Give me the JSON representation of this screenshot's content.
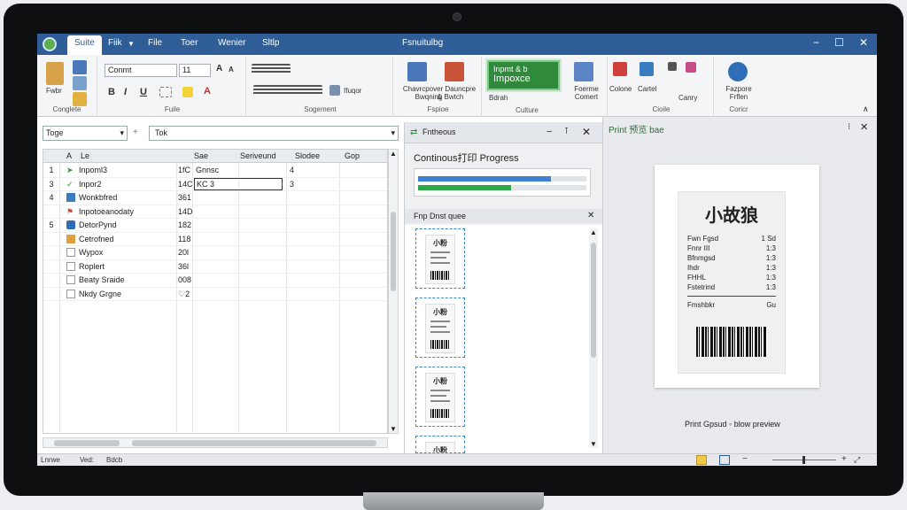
{
  "titlebar": {
    "tabs": [
      "Suite",
      "Fiik",
      "File",
      "Toer",
      "Wenier",
      "Sltlp"
    ],
    "window_title": "Fsnuitulbg",
    "minimize": "−",
    "maximize": "☐",
    "close": "✕"
  },
  "ribbon": {
    "clipboard": {
      "paste": "Fwbr",
      "label": "Conglete"
    },
    "font": {
      "name": "Conmt",
      "size": "11",
      "bold": "B",
      "italic": "I",
      "underline": "U",
      "label": "Fuile"
    },
    "alignment": {
      "label": "Sogement",
      "merge": "Ifuqor"
    },
    "figure": {
      "btn1": "Chavrcpover Dauncpre &",
      "btn2": "Bwqning Bwtch",
      "label": "Fspioe"
    },
    "import": {
      "line1": "Inpmt & b",
      "line2": "Impoxce",
      "line3": "Bdrah",
      "label": "Culture"
    },
    "tools": {
      "btn1": "Foerme",
      "btn2": "Comert",
      "label": ""
    },
    "color": {
      "btn1": "Colone",
      "btn2": "Cartel",
      "btn3": "Canry",
      "label": "Cioile"
    },
    "extra": {
      "btn1": "Fazpore",
      "btn2": "Frflen",
      "label": "Coricr"
    }
  },
  "formula_bar": {
    "name_box": "Toge",
    "formula": "Tok"
  },
  "grid": {
    "headers": [
      "A",
      "Le",
      "Sae",
      "Seriveund",
      "Slodee",
      "Gop"
    ],
    "rows": [
      {
        "num": "1",
        "name": "Inpoml3",
        "val": "1fC",
        "note": "Gnnsc",
        "c4": "4"
      },
      {
        "num": "3",
        "name": "Inpor2",
        "val": "14C",
        "note": "KC 3",
        "c4": "3"
      },
      {
        "num": "4",
        "name": "Wonkbfred",
        "val": "361",
        "note": "",
        "c4": ""
      },
      {
        "num": "",
        "name": "Inpotoeanodaty",
        "val": "14D",
        "note": "",
        "c4": ""
      },
      {
        "num": "5",
        "name": "DetorPynd",
        "val": "182",
        "note": "",
        "c4": ""
      },
      {
        "num": "",
        "name": "Cetrofned",
        "val": "118",
        "note": "",
        "c4": ""
      },
      {
        "num": "",
        "name": "Wypox",
        "val": "20l",
        "note": "",
        "c4": ""
      },
      {
        "num": "",
        "name": "Roplert",
        "val": "36l",
        "note": "",
        "c4": ""
      },
      {
        "num": "",
        "name": "Beaty Sraide",
        "val": "008",
        "note": "",
        "c4": ""
      },
      {
        "num": "",
        "name": "Nkdy Grgne",
        "val": "♡2",
        "note": "",
        "c4": ""
      }
    ]
  },
  "taskpane": {
    "title": "Fntheous",
    "progress_title": "Continous打印 Progress",
    "progress": [
      0.79,
      0.55
    ],
    "queue_title": "Fnp Dnst quee",
    "thumb_label": "小粉"
  },
  "preview": {
    "title": "Print 预览 bae",
    "receipt_title": "小故狼",
    "lines": [
      {
        "l": "Fwn Fgsd",
        "r": "1 Sd"
      },
      {
        "l": "Fnnr III",
        "r": "1:3"
      },
      {
        "l": "Bfnmgsd",
        "r": "1:3"
      },
      {
        "l": "Ihdr",
        "r": "1:3"
      },
      {
        "l": "FHHL",
        "r": "1:3"
      },
      {
        "l": "Fstetrind",
        "r": "1:3"
      },
      {
        "l": "Fmshbkr",
        "r": "Gu"
      }
    ],
    "footer": "Print Gpsud ◦ blow preview"
  },
  "statusbar": {
    "left": [
      "Lnrwe",
      "Ved:",
      "Bdcb"
    ],
    "zoom_minus": "−",
    "zoom_plus": "+"
  },
  "colors": {
    "titlebar": "#2f5d97",
    "accent_green": "#2f8a3c",
    "progress_blue": "#3d7fd1",
    "progress_green": "#2fa84a"
  }
}
